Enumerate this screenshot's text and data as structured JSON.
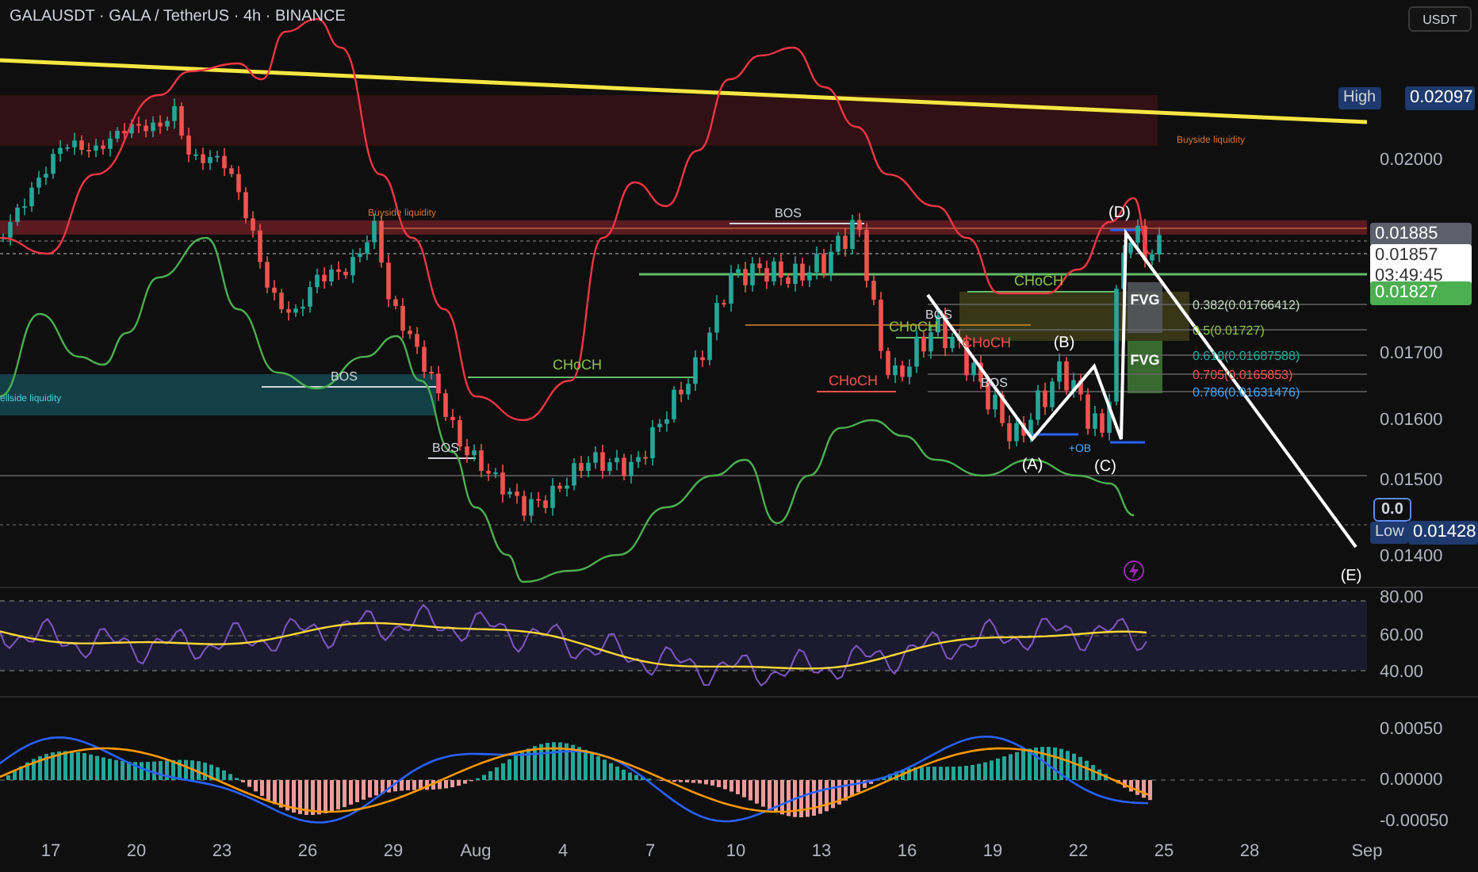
{
  "header": {
    "title": "GALAUSDT · GALA / TetherUS · 4h · BINANCE"
  },
  "currency_button": "USDT",
  "price_axis": {
    "ticks": [
      "0.02000",
      "0.01700",
      "0.01600",
      "0.01500",
      "0.01400"
    ],
    "high": {
      "label": "High",
      "value": "0.02097"
    },
    "low": {
      "label": "Low",
      "value": "0.01428",
      "partial": "0.0"
    },
    "badges": [
      {
        "kind": "level",
        "value": "0.01885"
      },
      {
        "kind": "last",
        "value": "0.01857",
        "countdown": "03:49:45"
      },
      {
        "kind": "target",
        "value": "0.01827"
      }
    ]
  },
  "annotations": [
    {
      "kind": "bos",
      "text": "BOS"
    },
    {
      "kind": "bos",
      "text": "BOS"
    },
    {
      "kind": "bos",
      "text": "BOS"
    },
    {
      "kind": "bos",
      "text": "BOS"
    },
    {
      "kind": "bos",
      "text": "BOS"
    },
    {
      "kind": "choch-bull",
      "text": "CHoCH"
    },
    {
      "kind": "choch-bull",
      "text": "CHoCH"
    },
    {
      "kind": "choch-bull",
      "text": "CHoCH"
    },
    {
      "kind": "choch-bear",
      "text": "CHoCH"
    },
    {
      "kind": "choch-bear",
      "text": "CHoCH"
    },
    {
      "kind": "fvg",
      "text": "FVG"
    },
    {
      "kind": "fvg",
      "text": "FVG"
    },
    {
      "kind": "ob",
      "text": "+OB"
    }
  ],
  "liquidity_labels": [
    {
      "kind": "sellside",
      "text": "ellside liquidity"
    },
    {
      "kind": "buyside",
      "text": "Buyside liquidity"
    },
    {
      "kind": "buyside",
      "text": "Buyside liquidity"
    }
  ],
  "fib_levels": [
    {
      "label": "0.382(0.01766412)",
      "color": "#c5d9c0"
    },
    {
      "label": "0.5(0.01727)",
      "color": "#8bc34a"
    },
    {
      "label": "0.618(0.01687588)",
      "color": "#26a69a"
    },
    {
      "label": "0.705(0.0165853)",
      "color": "#ef5350"
    },
    {
      "label": "0.786(0.01631476)",
      "color": "#42a5f5"
    }
  ],
  "waves": [
    "(A)",
    "(B)",
    "(C)",
    "(D)",
    "(E)"
  ],
  "rsi": {
    "ticks": [
      "80.00",
      "60.00",
      "40.00"
    ]
  },
  "macd": {
    "ticks": [
      "0.00050",
      "0.00000",
      "-0.00050"
    ]
  },
  "time_axis": [
    "17",
    "20",
    "23",
    "26",
    "29",
    "Aug",
    "4",
    "7",
    "10",
    "13",
    "16",
    "19",
    "22",
    "25",
    "28",
    "Sep"
  ]
}
